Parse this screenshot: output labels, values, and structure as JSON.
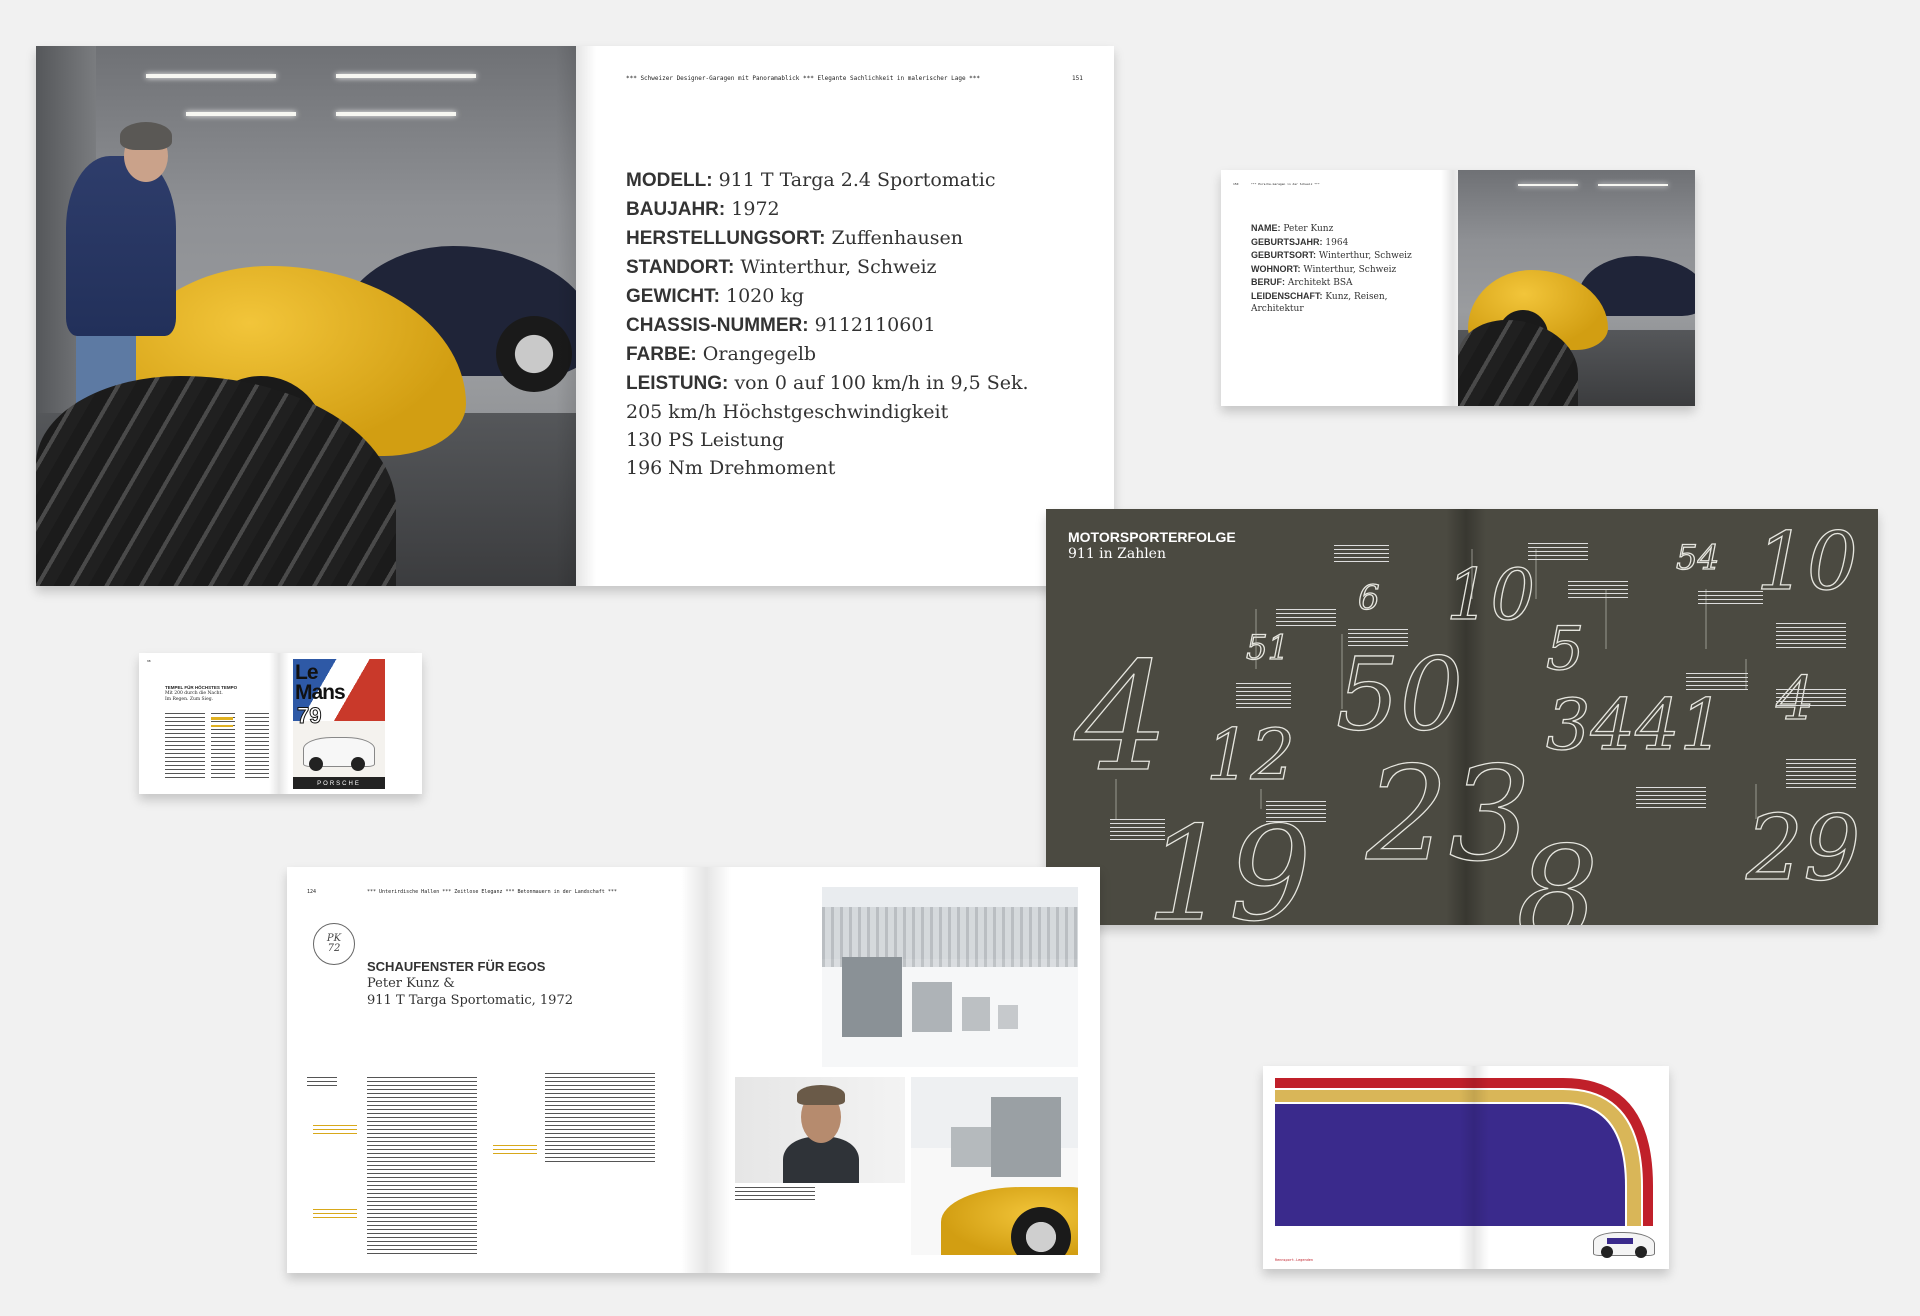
{
  "spread_main": {
    "running_head": "*** Schweizer Designer-Garagen mit Panoramablick *** Elegante Sachlichkeit in malerischer Lage ***",
    "page_number": "151",
    "specs": [
      {
        "label": "MODELL:",
        "value": "911 T Targa 2.4 Sportomatic"
      },
      {
        "label": "BAUJAHR:",
        "value": "1972"
      },
      {
        "label": "HERSTELLUNGSORT:",
        "value": "Zuffenhausen"
      },
      {
        "label": "STANDORT:",
        "value": "Winterthur, Schweiz"
      },
      {
        "label": "GEWICHT:",
        "value": "1020 kg"
      },
      {
        "label": "CHASSIS-NUMMER:",
        "value": "9112110601"
      },
      {
        "label": "FARBE:",
        "value": "Orangegelb"
      },
      {
        "label": "LEISTUNG:",
        "value": "von 0 auf 100 km/h in 9,5 Sek."
      }
    ],
    "spec_continuation": [
      "205 km/h Höchstgeschwindigkeit",
      "130 PS Leistung",
      "196 Nm Drehmoment"
    ]
  },
  "spread_person": {
    "page_number": "150",
    "running_head": "*** Porsche-Garagen in der Schweiz ***",
    "details": [
      {
        "label": "NAME:",
        "value": "Peter Kunz"
      },
      {
        "label": "GEBURTSJAHR:",
        "value": "1964"
      },
      {
        "label": "GEBURTSORT:",
        "value": "Winterthur, Schweiz"
      },
      {
        "label": "WOHNORT:",
        "value": "Winterthur, Schweiz"
      },
      {
        "label": "BERUF:",
        "value": "Architekt BSA"
      },
      {
        "label": "LEIDENSCHAFT:",
        "value": "Kunz, Reisen,"
      }
    ],
    "detail_continuation": "Architektur"
  },
  "spread_numbers": {
    "title": "MOTORSPORTERFOLGE",
    "subtitle": "911 in Zahlen",
    "numbers": [
      "4",
      "12",
      "51",
      "6",
      "50",
      "10",
      "5",
      "19",
      "23",
      "8",
      "3441",
      "54",
      "10",
      "4",
      "29"
    ]
  },
  "spread_lemans": {
    "page_number": "98",
    "heading_line1": "TEMPEL FÜR HÖCHSTES TEMPO",
    "heading_line2": "Mit 200 durch die Nacht.",
    "heading_line3": "Im Regen. Zum Sieg.",
    "poster_line1": "Le",
    "poster_line2": "Mans",
    "poster_line3": "79",
    "poster_brand": "PORSCHE"
  },
  "spread_egos": {
    "page_number": "124",
    "running_head": "*** Unterirdische Hallen *** Zeitlose Eleganz *** Betonmauern in der Landschaft ***",
    "logo_text": "PK 72",
    "title": "SCHAUFENSTER FÜR EGOS",
    "subtitle_line1": "Peter Kunz &",
    "subtitle_line2": "911 T Targa Sportomatic, 1972"
  },
  "spread_stripes": {
    "footer": "Rennsport-Legenden"
  },
  "colors": {
    "background": "#f1f1f1",
    "dark_page": "#4b4a41",
    "porsche_yellow": "#e0b020",
    "stripe_red": "#c0202a",
    "stripe_blue": "#3a2a8c",
    "stripe_gold": "#d9b658",
    "accent_yellow_text": "#d8a81a"
  }
}
